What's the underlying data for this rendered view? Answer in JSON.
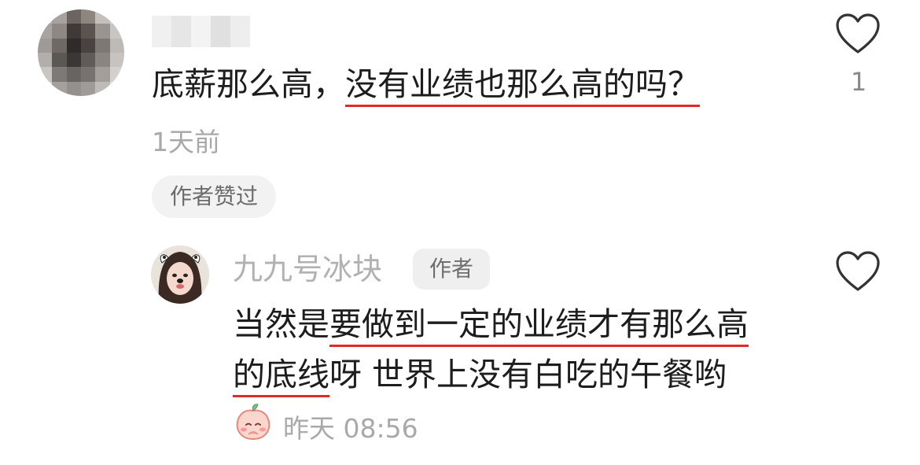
{
  "comment": {
    "text_before": "底薪那么高，",
    "text_highlight": "没有业绩也那么高的吗？",
    "time": "1天前",
    "badge": "作者赞过",
    "like_count": "1",
    "avatar_icon": "blurred-avatar"
  },
  "reply": {
    "username": "九九号冰块",
    "author_badge": "作者",
    "text_part1": "当然是",
    "text_highlight1": "要做到一定的业绩才有那么高",
    "text_highlight2": "的底线",
    "text_part2": "呀 世界上没有白吃的午餐哟",
    "time": "昨天 08:56",
    "avatar_icon": "girl-with-dog-filter-avatar",
    "sticker_icon": "peach-sticker-icon"
  },
  "colors": {
    "highlight_underline": "#e02a2a",
    "text_primary": "#1d1d1d",
    "text_secondary": "#a9a9a9"
  }
}
